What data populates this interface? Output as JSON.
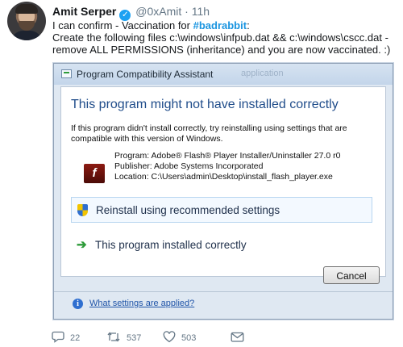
{
  "tweet": {
    "author_name": "Amit Serper",
    "handle": "@0xAmit",
    "separator": "·",
    "time": "11h",
    "line1_prefix": "I can confirm - Vaccination for ",
    "hashtag": "#badrabbit",
    "line1_suffix": ":",
    "line2": "Create the following files c:\\windows\\infpub.dat && c:\\windows\\cscc.dat -",
    "line3": "remove ALL PERMISSIONS (inheritance) and you are now vaccinated. :)"
  },
  "dialog": {
    "title": "Program Compatibility Assistant",
    "faded_title": "application",
    "headline": "This program might not have installed correctly",
    "description": "If this program didn't install correctly, try reinstalling using settings that are compatible with this version of Windows.",
    "program": "Program: Adobe® Flash® Player Installer/Uninstaller 27.0 r0",
    "publisher": "Publisher: Adobe Systems Incorporated",
    "location": "Location: C:\\Users\\admin\\Desktop\\install_flash_player.exe",
    "option_reinstall": "Reinstall using recommended settings",
    "option_ok": "This program installed correctly",
    "cancel_label": "Cancel",
    "help_link": "What settings are applied?"
  },
  "actions": {
    "replies": "22",
    "retweets": "537",
    "likes": "503"
  },
  "colors": {
    "hashtag": "#1b95e0",
    "headline": "#1f4c8a",
    "muted": "#657786",
    "verified": "#1da1f2"
  }
}
